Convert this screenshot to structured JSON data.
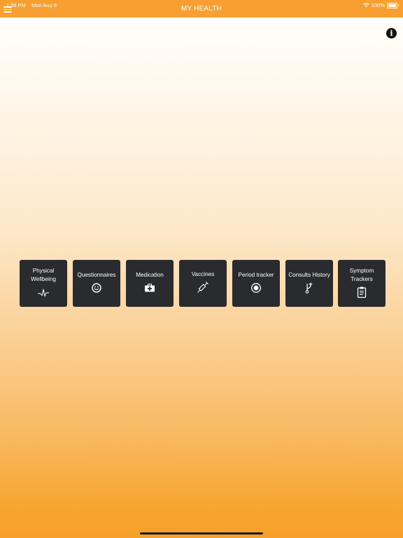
{
  "status_bar": {
    "time": "1:36 PM",
    "date": "Mon Aug 8",
    "battery_text": "100%"
  },
  "nav": {
    "title": "MY HEALTH",
    "menu_icon": "hamburger-menu-icon",
    "info_icon": "info-icon",
    "info_glyph": "i"
  },
  "tiles": [
    {
      "label": "Physical\nWellbeing",
      "icon": "heartbeat-icon"
    },
    {
      "label": "Questionnaires",
      "icon": "smiley-icon"
    },
    {
      "label": "Medication",
      "icon": "medical-kit-icon"
    },
    {
      "label": "Vaccines",
      "icon": "syringe-icon"
    },
    {
      "label": "Period tracker",
      "icon": "radio-dot-icon"
    },
    {
      "label": "Consults History",
      "icon": "branch-icon"
    },
    {
      "label": "Symptom\nTrackers",
      "icon": "clipboard-icon"
    }
  ],
  "colors": {
    "accent": "#f7a031",
    "tile_bg": "#2a2b2e",
    "text_on_dark": "#ffffff"
  }
}
